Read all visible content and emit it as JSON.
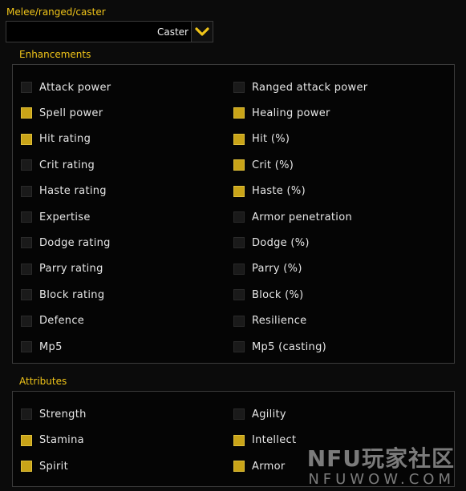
{
  "role": {
    "label": "Melee/ranged/caster",
    "selected": "Caster"
  },
  "enhancements": {
    "title": "Enhancements",
    "left": [
      {
        "label": "Attack power",
        "checked": false
      },
      {
        "label": "Spell power",
        "checked": true
      },
      {
        "label": "Hit rating",
        "checked": true
      },
      {
        "label": "Crit rating",
        "checked": false
      },
      {
        "label": "Haste rating",
        "checked": false
      },
      {
        "label": "Expertise",
        "checked": false
      },
      {
        "label": "Dodge rating",
        "checked": false
      },
      {
        "label": "Parry rating",
        "checked": false
      },
      {
        "label": "Block rating",
        "checked": false
      },
      {
        "label": "Defence",
        "checked": false
      },
      {
        "label": "Mp5",
        "checked": false
      }
    ],
    "right": [
      {
        "label": "Ranged attack power",
        "checked": false
      },
      {
        "label": "Healing power",
        "checked": true
      },
      {
        "label": "Hit (%)",
        "checked": true
      },
      {
        "label": "Crit (%)",
        "checked": true
      },
      {
        "label": "Haste (%)",
        "checked": true
      },
      {
        "label": "Armor penetration",
        "checked": false
      },
      {
        "label": "Dodge (%)",
        "checked": false
      },
      {
        "label": "Parry (%)",
        "checked": false
      },
      {
        "label": "Block (%)",
        "checked": false
      },
      {
        "label": "Resilience",
        "checked": false
      },
      {
        "label": "Mp5 (casting)",
        "checked": false
      }
    ]
  },
  "attributes": {
    "title": "Attributes",
    "left": [
      {
        "label": "Strength",
        "checked": false
      },
      {
        "label": "Stamina",
        "checked": true
      },
      {
        "label": "Spirit",
        "checked": true
      }
    ],
    "right": [
      {
        "label": "Agility",
        "checked": false
      },
      {
        "label": "Intellect",
        "checked": true
      },
      {
        "label": "Armor",
        "checked": true
      }
    ]
  },
  "watermark": {
    "line1": "NFU玩家社区",
    "line2": "NFUWOW.COM"
  },
  "colors": {
    "accent": "#f0c419",
    "checked": "#c9a418",
    "unchecked": "#1a1a1a"
  }
}
